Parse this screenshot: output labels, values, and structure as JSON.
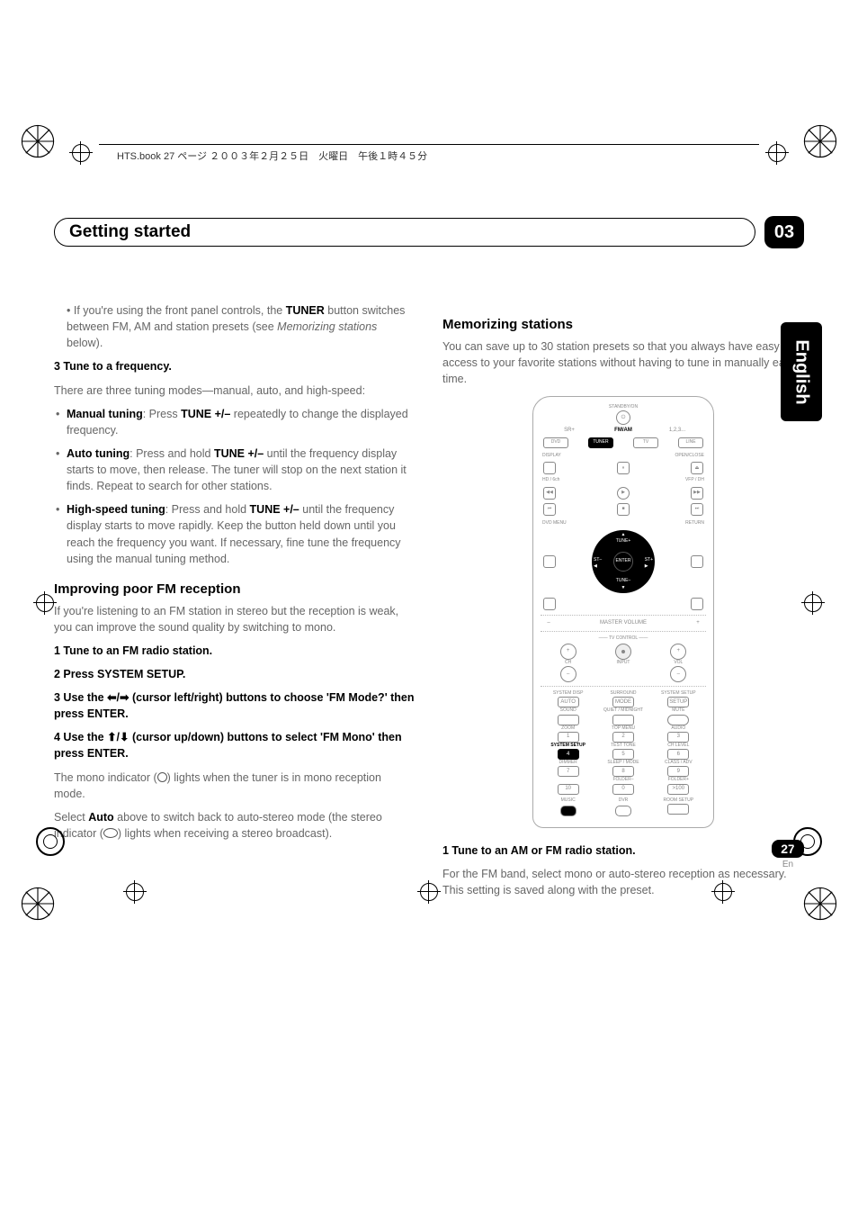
{
  "header": {
    "jp_line": "HTS.book 27 ページ ２００３年２月２５日　火曜日　午後１時４５分"
  },
  "chapter": {
    "title": "Getting started",
    "number": "03"
  },
  "side_tab": "English",
  "left": {
    "p1_prefix": "• If you're using the front panel controls, the ",
    "p1_bold1": "TUNER",
    "p1_mid": " button switches between FM, AM and station presets (see ",
    "p1_em": "Memorizing stations",
    "p1_suffix": " below).",
    "step3": "3   Tune to a frequency.",
    "p2": "There are three tuning modes—manual, auto, and high-speed:",
    "b1_label": "Manual tuning",
    "b1_mid": ": Press ",
    "b1_bold": "TUNE +/–",
    "b1_tail": " repeatedly to change the displayed frequency.",
    "b2_label": "Auto tuning",
    "b2_mid": ": Press and hold ",
    "b2_bold": "TUNE +/–",
    "b2_tail": " until the frequency display starts to move, then release. The tuner will stop on the next station it finds. Repeat to search for other stations.",
    "b3_label": "High-speed tuning",
    "b3_mid": ": Press and hold ",
    "b3_bold": "TUNE +/–",
    "b3_tail": " until the frequency display starts to move rapidly. Keep the button held down until you reach the frequency you want. If necessary, fine tune the frequency using the manual tuning method.",
    "h2": "Improving poor FM reception",
    "p3": "If you're listening to an FM station in stereo but the reception is weak, you can improve the sound quality by switching to mono.",
    "s1": "1   Tune to an FM radio station.",
    "s2": "2   Press SYSTEM SETUP.",
    "s3a": "3   Use the ",
    "s3b": " (cursor left/right) buttons to choose 'FM Mode?' then press ENTER.",
    "s4a": "4   Use the ",
    "s4b": " (cursor up/down) buttons to select 'FM Mono' then press ENTER.",
    "p4a": "The mono indicator (",
    "p4b": ") lights when the tuner is in mono reception mode.",
    "p5a": "Select ",
    "p5bold": "Auto",
    "p5b": " above to switch back to auto-stereo mode (the stereo indicator (",
    "p5c": ") lights when receiving a stereo broadcast)."
  },
  "right": {
    "h2": "Memorizing stations",
    "intro": "You can save up to 30 station presets so that you always have easy access to your favorite stations without having to tune in manually each time.",
    "remote": {
      "standby": "STANDBY/ON",
      "src_row": {
        "a": "SR+",
        "b": "FM/AM",
        "c": "1,2,3...",
        "dvd": "DVD",
        "tuner": "TUNER",
        "tv": "TV",
        "line": "LINE"
      },
      "row2": {
        "display": "DISPLAY",
        "open": "OPEN/CLOSE",
        "hd": "HD / 6ch",
        "vfp": "VFP / DH"
      },
      "dvd_menu": "DVD MENU",
      "return": "RETURN",
      "enter": "ENTER",
      "tune_p": "TUNE+",
      "tune_m": "TUNE–",
      "st_m": "ST–",
      "st_p": "ST+",
      "master": "MASTER VOLUME",
      "tvc": "TV CONTROL",
      "ch": "CH",
      "input": "INPUT",
      "vol": "VOL",
      "row_a": {
        "a": "SYSTEM DISP",
        "b": "SURROUND",
        "c": "SYSTEM SETUP",
        "x": "AUTO",
        "y": "MODE",
        "z": "SETUP"
      },
      "row_b": {
        "a": "SOUND",
        "b": "QUIET / MIDNIGHT",
        "c": "MUTE"
      },
      "row_c": {
        "a": "ZOOM",
        "b": "TOP MENU",
        "c": "AUDIO",
        "n1": "1",
        "n2": "2",
        "n3": "3"
      },
      "row_d": {
        "a": "SYSTEM SETUP",
        "b": "TEST TONE",
        "c": "CH LEVEL",
        "n4": "4",
        "n5": "5",
        "n6": "6"
      },
      "row_e": {
        "a": "DIMMER",
        "b": "SLEEP / MODE",
        "c": "CLASS / ADV",
        "n7": "7",
        "n8": "8",
        "n9": "9"
      },
      "row_f": {
        "a": "",
        "b": "FOLDER–",
        "c": "FOLDER+",
        "n10": "10",
        "n0": "0",
        "n100": ">100"
      },
      "bottom": {
        "a": "MUSIC",
        "b": "DVR",
        "c": "ROOM SETUP"
      }
    },
    "s1": "1   Tune to an AM or FM radio station.",
    "p2": "For the FM band, select mono or auto-stereo reception as necessary. This setting is saved along with the preset."
  },
  "footer": {
    "page": "27",
    "lang": "En"
  }
}
